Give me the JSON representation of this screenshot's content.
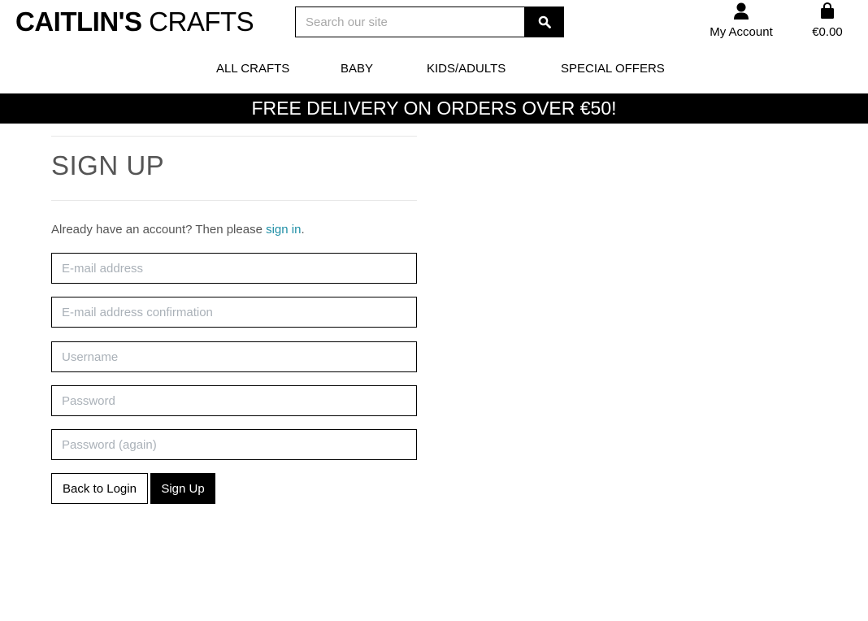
{
  "brand": {
    "name_bold": "CAITLIN'S",
    "name_light": " CRAFTS"
  },
  "search": {
    "placeholder": "Search our site",
    "icon": "search-icon"
  },
  "account": {
    "label": "My Account",
    "icon": "user-icon"
  },
  "bag": {
    "label": "€0.00",
    "icon": "shopping-bag-icon"
  },
  "nav": {
    "items": [
      {
        "label": "ALL CRAFTS"
      },
      {
        "label": "BABY"
      },
      {
        "label": "KIDS/ADULTS"
      },
      {
        "label": "SPECIAL OFFERS"
      }
    ]
  },
  "banner": {
    "text": "FREE DELIVERY ON ORDERS OVER €50!"
  },
  "signup": {
    "title": "SIGN UP",
    "intro_prefix": "Already have an account? Then please ",
    "intro_link": "sign in",
    "intro_suffix": ".",
    "fields": [
      {
        "placeholder": "E-mail address",
        "value": ""
      },
      {
        "placeholder": "E-mail address confirmation",
        "value": ""
      },
      {
        "placeholder": "Username",
        "value": ""
      },
      {
        "placeholder": "Password",
        "value": ""
      },
      {
        "placeholder": "Password (again)",
        "value": ""
      }
    ],
    "back_label": "Back to Login",
    "submit_label": "Sign Up"
  },
  "colors": {
    "accent": "#000000",
    "link": "#1f8fa6",
    "banner_bg": "#000000",
    "banner_text": "#ffffff"
  }
}
